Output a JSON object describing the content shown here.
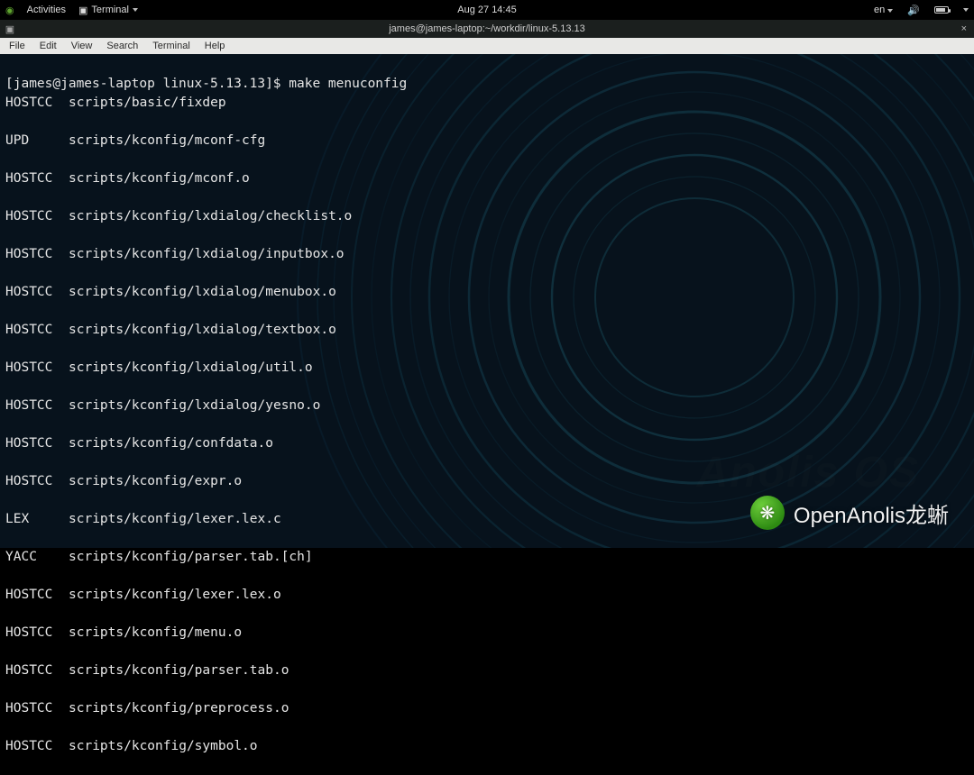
{
  "topbar": {
    "activities": "Activities",
    "app_name": "Terminal",
    "clock": "Aug 27  14:45",
    "lang": "en"
  },
  "title": "james@james-laptop:~/workdir/linux-5.13.13",
  "menus": [
    "File",
    "Edit",
    "View",
    "Search",
    "Terminal",
    "Help"
  ],
  "prompt": "[james@james-laptop linux-5.13.13]$ ",
  "command": "make menuconfig",
  "lines": [
    {
      "tool": "HOSTCC",
      "file": "scripts/basic/fixdep"
    },
    {
      "tool": "UPD",
      "file": "scripts/kconfig/mconf-cfg"
    },
    {
      "tool": "HOSTCC",
      "file": "scripts/kconfig/mconf.o"
    },
    {
      "tool": "HOSTCC",
      "file": "scripts/kconfig/lxdialog/checklist.o"
    },
    {
      "tool": "HOSTCC",
      "file": "scripts/kconfig/lxdialog/inputbox.o"
    },
    {
      "tool": "HOSTCC",
      "file": "scripts/kconfig/lxdialog/menubox.o"
    },
    {
      "tool": "HOSTCC",
      "file": "scripts/kconfig/lxdialog/textbox.o"
    },
    {
      "tool": "HOSTCC",
      "file": "scripts/kconfig/lxdialog/util.o"
    },
    {
      "tool": "HOSTCC",
      "file": "scripts/kconfig/lxdialog/yesno.o"
    },
    {
      "tool": "HOSTCC",
      "file": "scripts/kconfig/confdata.o"
    },
    {
      "tool": "HOSTCC",
      "file": "scripts/kconfig/expr.o"
    },
    {
      "tool": "LEX",
      "file": "scripts/kconfig/lexer.lex.c"
    },
    {
      "tool": "YACC",
      "file": "scripts/kconfig/parser.tab.[ch]"
    },
    {
      "tool": "HOSTCC",
      "file": "scripts/kconfig/lexer.lex.o"
    },
    {
      "tool": "HOSTCC",
      "file": "scripts/kconfig/menu.o"
    },
    {
      "tool": "HOSTCC",
      "file": "scripts/kconfig/parser.tab.o"
    },
    {
      "tool": "HOSTCC",
      "file": "scripts/kconfig/preprocess.o"
    },
    {
      "tool": "HOSTCC",
      "file": "scripts/kconfig/symbol.o"
    }
  ],
  "watermark": "OpenAnolis龙蜥",
  "brand_bg": "Anolis OS",
  "close_glyph": "×",
  "tab_glyph": "▣",
  "speaker_glyph": "🔊",
  "wechat_glyph": "❋"
}
